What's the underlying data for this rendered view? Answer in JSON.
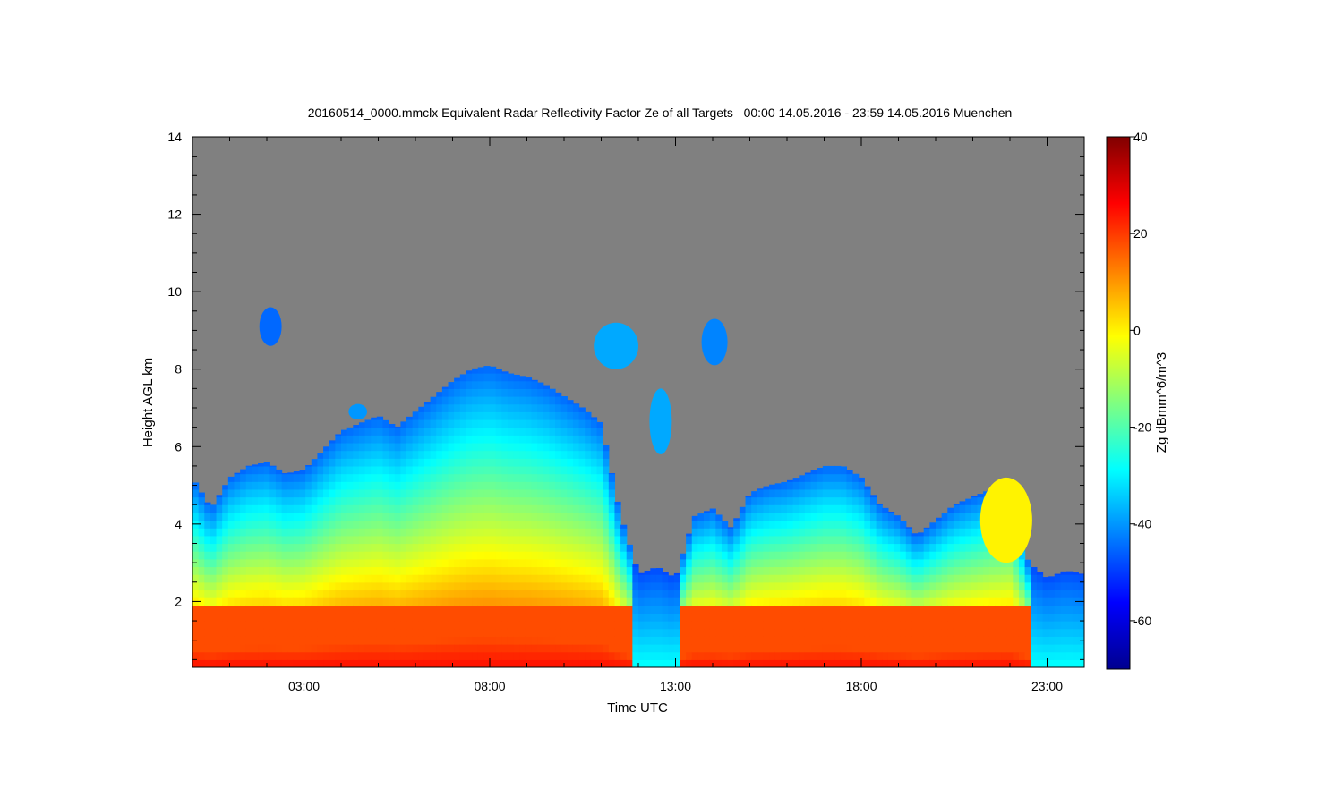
{
  "chart_data": {
    "type": "heatmap",
    "title": "20160514_0000.mmclx Equivalent Radar Reflectivity Factor Ze of all Targets   00:00 14.05.2016 - 23:59 14.05.2016 Muenchen",
    "xlabel": "Time UTC",
    "ylabel": "Height AGL km",
    "colorbar_label": "Zg dBmm^6/m^3",
    "xlim": [
      0.0,
      24.0
    ],
    "ylim": [
      0.3,
      14.0
    ],
    "clim": [
      -70,
      40
    ],
    "x_ticks": [
      {
        "value": 3,
        "label": "03:00"
      },
      {
        "value": 8,
        "label": "08:00"
      },
      {
        "value": 13,
        "label": "13:00"
      },
      {
        "value": 18,
        "label": "18:00"
      },
      {
        "value": 23,
        "label": "23:00"
      }
    ],
    "y_ticks": [
      {
        "value": 2,
        "label": "2"
      },
      {
        "value": 4,
        "label": "4"
      },
      {
        "value": 6,
        "label": "6"
      },
      {
        "value": 8,
        "label": "8"
      },
      {
        "value": 10,
        "label": "10"
      },
      {
        "value": 12,
        "label": "12"
      },
      {
        "value": 14,
        "label": "14"
      }
    ],
    "colorbar_ticks": [
      {
        "value": 40,
        "label": "40"
      },
      {
        "value": 20,
        "label": "20"
      },
      {
        "value": 0,
        "label": "0"
      },
      {
        "value": -20,
        "label": "-20"
      },
      {
        "value": -40,
        "label": "-40"
      },
      {
        "value": -60,
        "label": "-60"
      }
    ],
    "colormap": "jet",
    "no_signal_color": "#808080",
    "cloud_top_km": {
      "time_h": [
        0.0,
        0.5,
        1.0,
        1.5,
        2.0,
        2.5,
        3.0,
        3.5,
        4.0,
        4.5,
        5.0,
        5.5,
        6.0,
        6.5,
        7.0,
        7.5,
        8.0,
        8.5,
        9.0,
        9.5,
        10.0,
        10.5,
        11.0,
        11.5,
        12.0,
        12.5,
        13.0,
        13.5,
        14.0,
        14.5,
        15.0,
        15.5,
        16.0,
        16.5,
        17.0,
        17.5,
        18.0,
        18.5,
        19.0,
        19.5,
        20.0,
        20.5,
        21.0,
        21.5,
        22.0,
        22.5,
        23.0,
        23.5,
        24.0
      ],
      "top_km": [
        5.2,
        4.4,
        5.2,
        5.5,
        5.6,
        5.3,
        5.4,
        5.9,
        6.4,
        6.6,
        6.8,
        6.5,
        6.9,
        7.3,
        7.7,
        8.0,
        8.1,
        7.9,
        7.8,
        7.6,
        7.3,
        7.0,
        6.6,
        4.3,
        2.7,
        2.9,
        2.6,
        4.2,
        4.4,
        3.9,
        4.8,
        5.0,
        5.1,
        5.3,
        5.5,
        5.5,
        5.2,
        4.5,
        4.2,
        3.7,
        4.1,
        4.5,
        4.7,
        4.9,
        5.0,
        3.0,
        2.6,
        2.8,
        2.7
      ]
    },
    "cloud_regions": [
      {
        "t0": 1.8,
        "t1": 2.4,
        "z0": 8.6,
        "z1": 9.6,
        "dbz": -45
      },
      {
        "t0": 4.2,
        "t1": 4.7,
        "z0": 6.7,
        "z1": 7.1,
        "dbz": -40
      },
      {
        "t0": 10.8,
        "t1": 12.0,
        "z0": 8.0,
        "z1": 9.2,
        "dbz": -38
      },
      {
        "t0": 13.7,
        "t1": 14.4,
        "z0": 8.1,
        "z1": 9.3,
        "dbz": -42
      },
      {
        "t0": 12.3,
        "t1": 12.9,
        "z0": 5.8,
        "z1": 7.5,
        "dbz": -38
      },
      {
        "t0": 21.2,
        "t1": 22.6,
        "z0": 3.0,
        "z1": 5.2,
        "dbz": 0
      }
    ],
    "surface_layer": {
      "t0": 0.0,
      "t1": 24.0,
      "z0": 0.3,
      "z1": 1.9,
      "dbz": 18
    }
  }
}
